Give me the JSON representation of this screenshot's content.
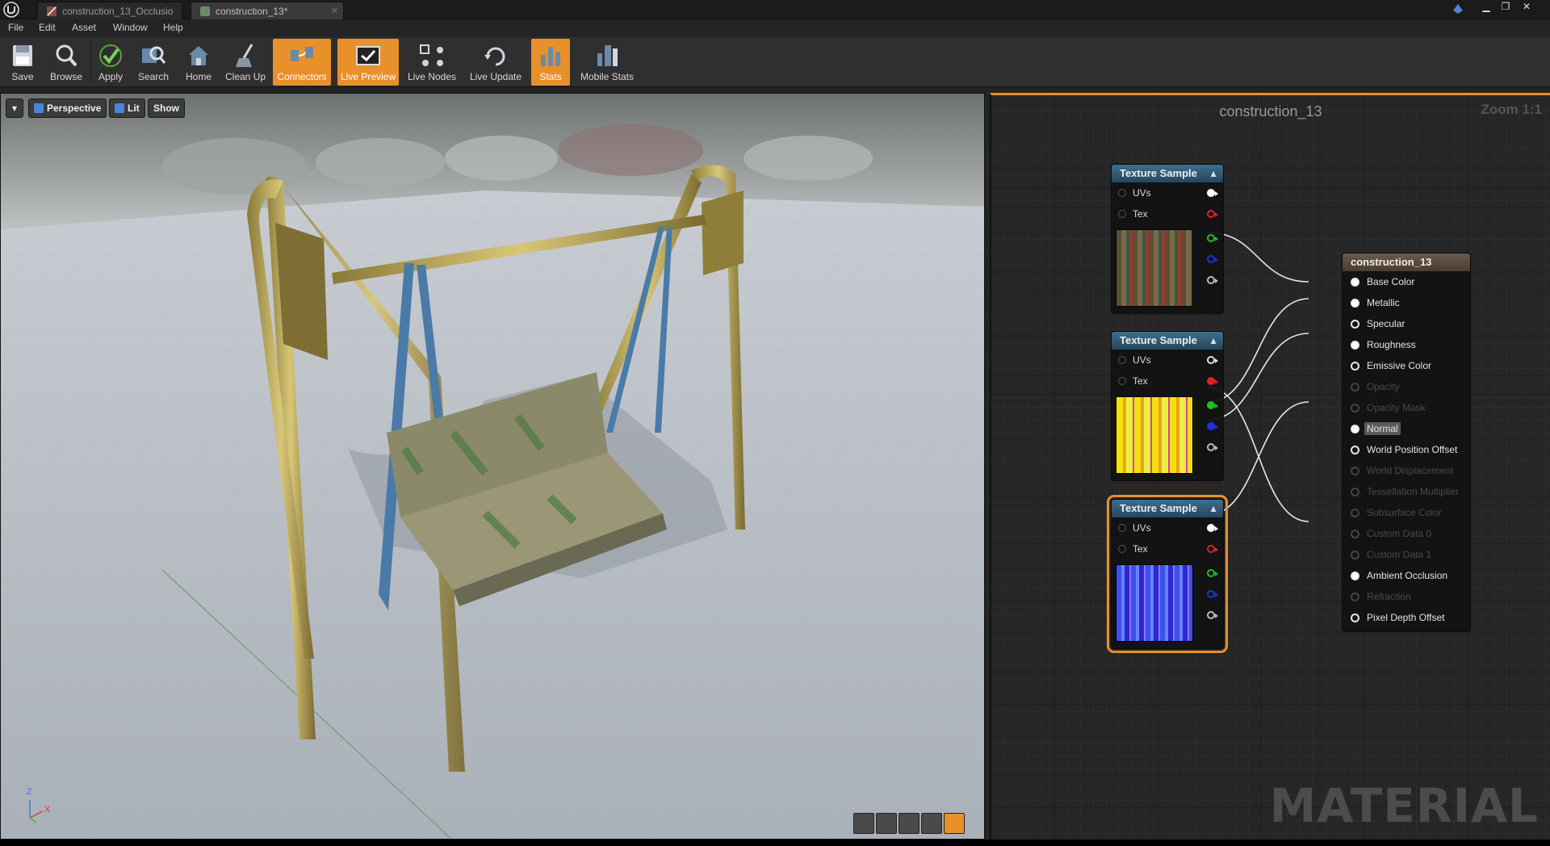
{
  "titlebar": {
    "tabs": [
      {
        "label": "construction_13_Occlusio",
        "active": false
      },
      {
        "label": "construction_13*",
        "active": true
      }
    ],
    "window_buttons": [
      "minimize",
      "restore",
      "close"
    ]
  },
  "menu": [
    "File",
    "Edit",
    "Asset",
    "Window",
    "Help"
  ],
  "toolbar": {
    "buttons": [
      {
        "label": "Save",
        "icon": "save-icon",
        "active": false
      },
      {
        "label": "Browse",
        "icon": "browse-icon",
        "active": false
      },
      {
        "label": "Apply",
        "icon": "apply-icon",
        "active": false
      },
      {
        "label": "Search",
        "icon": "search-icon",
        "active": false
      },
      {
        "label": "Home",
        "icon": "home-icon",
        "active": false
      },
      {
        "label": "Clean Up",
        "icon": "clean-up-icon",
        "active": false
      },
      {
        "label": "Connectors",
        "icon": "connectors-icon",
        "active": true
      },
      {
        "label": "Live Preview",
        "icon": "live-preview-icon",
        "active": true
      },
      {
        "label": "Live Nodes",
        "icon": "live-nodes-icon",
        "active": false
      },
      {
        "label": "Live Update",
        "icon": "live-update-icon",
        "active": false
      },
      {
        "label": "Stats",
        "icon": "stats-icon",
        "active": true
      },
      {
        "label": "Mobile Stats",
        "icon": "mobile-stats-icon",
        "active": false
      }
    ]
  },
  "viewport": {
    "perspective_label": "Perspective",
    "lit_label": "Lit",
    "show_label": "Show",
    "axis": {
      "z": "Z",
      "x": "X"
    }
  },
  "graph": {
    "title": "construction_13",
    "zoom": "Zoom 1:1",
    "watermark": "MATERIAL",
    "texture_nodes": [
      {
        "title": "Texture Sample",
        "inputs": [
          "UVs",
          "Tex"
        ],
        "outputs": [
          "RGB",
          "R",
          "G",
          "B",
          "A"
        ],
        "preview": "texture-base-color",
        "selected": false
      },
      {
        "title": "Texture Sample",
        "inputs": [
          "UVs",
          "Tex"
        ],
        "outputs": [
          "RGB",
          "R",
          "G",
          "B",
          "A"
        ],
        "preview": "texture-orm",
        "selected": false
      },
      {
        "title": "Texture Sample",
        "inputs": [
          "UVs",
          "Tex"
        ],
        "outputs": [
          "RGB",
          "R",
          "G",
          "B",
          "A"
        ],
        "preview": "texture-normal",
        "selected": true
      }
    ],
    "material_node": {
      "title": "construction_13",
      "pins": [
        {
          "label": "Base Color",
          "enabled": true,
          "connected": true
        },
        {
          "label": "Metallic",
          "enabled": true,
          "connected": true
        },
        {
          "label": "Specular",
          "enabled": true,
          "connected": false
        },
        {
          "label": "Roughness",
          "enabled": true,
          "connected": true
        },
        {
          "label": "Emissive Color",
          "enabled": true,
          "connected": false
        },
        {
          "label": "Opacity",
          "enabled": false,
          "connected": false
        },
        {
          "label": "Opacity Mask",
          "enabled": false,
          "connected": false
        },
        {
          "label": "Normal",
          "enabled": true,
          "connected": true,
          "highlighted": true
        },
        {
          "label": "World Position Offset",
          "enabled": true,
          "connected": false
        },
        {
          "label": "World Displacement",
          "enabled": false,
          "connected": false
        },
        {
          "label": "Tessellation Multiplier",
          "enabled": false,
          "connected": false
        },
        {
          "label": "Subsurface Color",
          "enabled": false,
          "connected": false
        },
        {
          "label": "Custom Data 0",
          "enabled": false,
          "connected": false
        },
        {
          "label": "Custom Data 1",
          "enabled": false,
          "connected": false
        },
        {
          "label": "Ambient Occlusion",
          "enabled": true,
          "connected": true
        },
        {
          "label": "Refraction",
          "enabled": false,
          "connected": false
        },
        {
          "label": "Pixel Depth Offset",
          "enabled": true,
          "connected": false
        }
      ]
    }
  },
  "colors": {
    "accent": "#e8902a",
    "node_header": "#2f5a78",
    "material_header": "#5a4a3e",
    "pin_red": "#e02020",
    "pin_green": "#20c020",
    "pin_blue": "#2030e0"
  }
}
